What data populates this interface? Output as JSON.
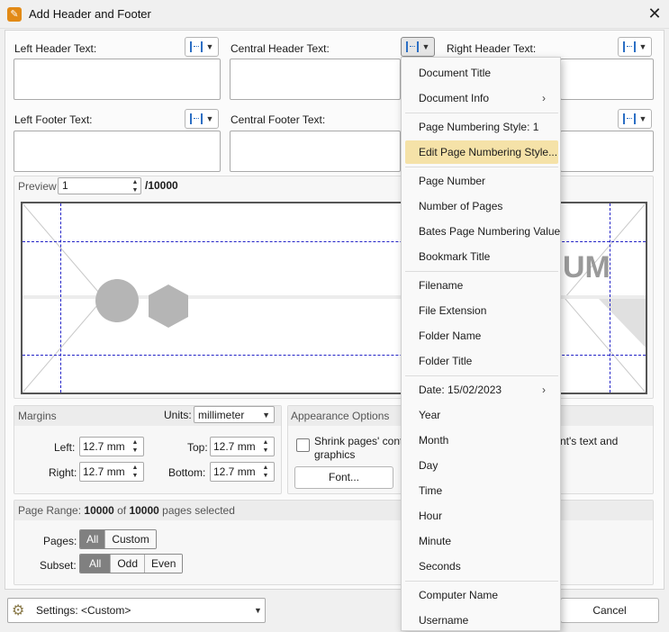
{
  "window": {
    "title": "Add Header and Footer",
    "app_icon": "pdf-xchange-icon"
  },
  "header": {
    "left_label": "Left Header Text:",
    "central_label": "Central Header Text:",
    "right_label": "Right Header Text:"
  },
  "footer": {
    "left_label": "Left Footer Text:",
    "central_label": "Central Footer Text:"
  },
  "preview": {
    "label": "Preview",
    "page_value": "1",
    "page_total": "/10000"
  },
  "margins": {
    "title": "Margins",
    "units_label": "Units:",
    "units_value": "millimeter",
    "left_label": "Left:",
    "left_value": "12.7 mm",
    "right_label": "Right:",
    "right_value": "12.7 mm",
    "top_label": "Top:",
    "top_value": "12.7 mm",
    "bottom_label": "Bottom:",
    "bottom_value": "12.7 mm"
  },
  "appearance": {
    "title": "Appearance Options",
    "shrink_line1": "Shrink pages' cont",
    "shrink_line2": "graphics",
    "font_button": "Font...",
    "right_fragment": "nt's text and"
  },
  "page_range": {
    "prefix": "Page Range: ",
    "count": "10000",
    "of": " of ",
    "total": "10000",
    "suffix": " pages selected",
    "pages_label": "Pages:",
    "pages_options": [
      "All",
      "Custom"
    ],
    "subset_label": "Subset:",
    "subset_options": [
      "All",
      "Odd",
      "Even"
    ]
  },
  "settings": {
    "label": "Settings:",
    "value": "<Custom>"
  },
  "buttons": {
    "cancel": "Cancel"
  },
  "menu": {
    "items": [
      "Document Title",
      "Document Info",
      "Page Numbering Style: 1",
      "Edit Page Numbering Style...",
      "Page Number",
      "Number of Pages",
      "Bates Page Numbering Value",
      "Bookmark Title",
      "Filename",
      "File Extension",
      "Folder Name",
      "Folder Title",
      "Date: 15/02/2023",
      "Year",
      "Month",
      "Day",
      "Time",
      "Hour",
      "Minute",
      "Seconds",
      "Computer Name",
      "Username"
    ],
    "highlighted": "Edit Page Numbering Style..."
  },
  "preview_watermark": "UM",
  "colors": {
    "accent": "#2c6fc4",
    "menu_highlight": "#f5e2a8",
    "guide": "#2323c7",
    "app_icon": "#e28a16"
  }
}
